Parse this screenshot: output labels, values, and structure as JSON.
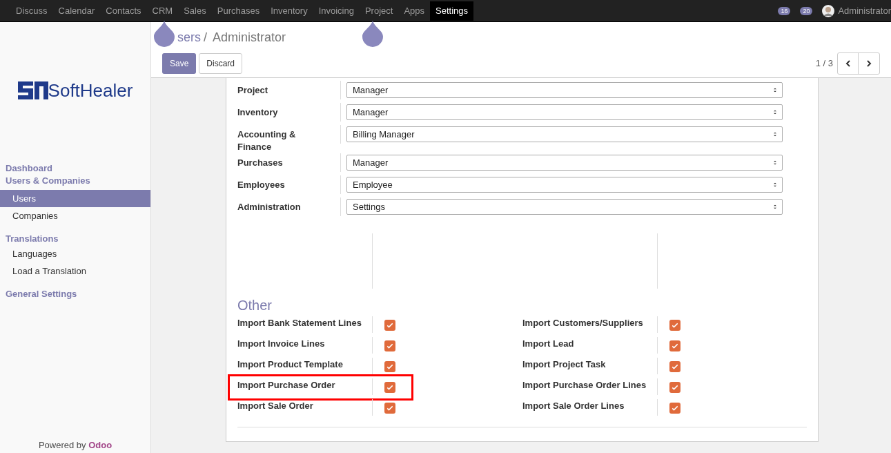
{
  "top_menu": [
    {
      "label": "Discuss",
      "selected": false
    },
    {
      "label": "Calendar",
      "selected": false
    },
    {
      "label": "Contacts",
      "selected": false
    },
    {
      "label": "CRM",
      "selected": false
    },
    {
      "label": "Sales",
      "selected": false
    },
    {
      "label": "Purchases",
      "selected": false
    },
    {
      "label": "Inventory",
      "selected": false
    },
    {
      "label": "Invoicing",
      "selected": false
    },
    {
      "label": "Project",
      "selected": false
    },
    {
      "label": "Apps",
      "selected": false
    },
    {
      "label": "Settings",
      "selected": true
    }
  ],
  "systray": {
    "activity_count": "16",
    "message_count": "20",
    "user": "Administrator"
  },
  "logo": {
    "text": "SoftHealer"
  },
  "sidebar": [
    {
      "label": "Dashboard",
      "kind": "section",
      "selected": false
    },
    {
      "label": "Users & Companies",
      "kind": "section",
      "selected": false
    },
    {
      "label": "Users",
      "kind": "item",
      "selected": true
    },
    {
      "label": "Companies",
      "kind": "item",
      "selected": false
    },
    {
      "label": "Translations",
      "kind": "section",
      "selected": false
    },
    {
      "label": "Languages",
      "kind": "item",
      "selected": false
    },
    {
      "label": "Load a Translation",
      "kind": "item",
      "selected": false
    },
    {
      "label": "General Settings",
      "kind": "section",
      "selected": false
    }
  ],
  "footer": {
    "text": "Powered by",
    "brand": "Odoo"
  },
  "breadcrumb": {
    "parent": "sers",
    "separator": "/",
    "current": "Administrator"
  },
  "buttons": {
    "save": "Save",
    "discard": "Discard"
  },
  "pager": {
    "text": "1 / 3"
  },
  "access_rights": [
    {
      "label": "Project",
      "value": "Manager"
    },
    {
      "label": "Inventory",
      "value": "Manager"
    },
    {
      "label": "Accounting & Finance",
      "value": "Billing Manager"
    },
    {
      "label": "Purchases",
      "value": "Manager"
    },
    {
      "label": "Employees",
      "value": "Employee"
    },
    {
      "label": "Administration",
      "value": "Settings"
    }
  ],
  "other": {
    "title": "Other",
    "items": [
      {
        "label": "Import Bank Statement Lines",
        "checked": true,
        "highlighted": false
      },
      {
        "label": "Import Customers/Suppliers",
        "checked": true,
        "highlighted": false
      },
      {
        "label": "Import Invoice Lines",
        "checked": true,
        "highlighted": false
      },
      {
        "label": "Import Lead",
        "checked": true,
        "highlighted": false
      },
      {
        "label": "Import Product Template",
        "checked": true,
        "highlighted": false
      },
      {
        "label": "Import Project Task",
        "checked": true,
        "highlighted": false
      },
      {
        "label": "Import Purchase Order",
        "checked": true,
        "highlighted": true
      },
      {
        "label": "Import Purchase Order Lines",
        "checked": true,
        "highlighted": false
      },
      {
        "label": "Import Sale Order",
        "checked": true,
        "highlighted": false
      },
      {
        "label": "Import Sale Order Lines",
        "checked": true,
        "highlighted": false
      }
    ]
  }
}
